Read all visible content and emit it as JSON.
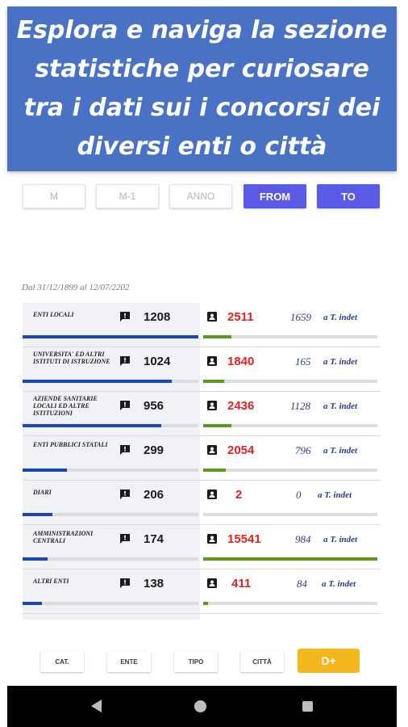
{
  "banner": {
    "text": "Esplora e naviga la sezione statistiche per curiosare tra i dati sui i concorsi dei diversi enti o città"
  },
  "filters": {
    "m": "M",
    "m1": "M-1",
    "anno": "ANNO",
    "from": "FROM",
    "to": "TO"
  },
  "date_range": "Dal 31/12/1899 al 12/07/2202",
  "indet_suffix": "a T. indet",
  "colors": {
    "banner": "#4a72c4",
    "active_filter": "#5a5ae6",
    "left_bar": "#1e45b8",
    "right_bar": "#5a9a1e",
    "red_count": "#e52222",
    "dplus": "#f5b81c"
  },
  "rows": [
    {
      "category": "ENTI LOCALI",
      "concorsi": "1208",
      "bandi": "2511",
      "indet": "1659",
      "left_level": 1.0,
      "right_level": 0.16
    },
    {
      "category": "UNIVERSITA' ED ALTRI ISTITUTI DI ISTRUZIONE",
      "concorsi": "1024",
      "bandi": "1840",
      "indet": "165",
      "left_level": 0.85,
      "right_level": 0.12
    },
    {
      "category": "AZIENDE SANITARIE LOCALI ED ALTRE ISTITUZIONI",
      "concorsi": "956",
      "bandi": "2436",
      "indet": "1128",
      "left_level": 0.79,
      "right_level": 0.16
    },
    {
      "category": "ENTI PUBBLICI STATALI",
      "concorsi": "299",
      "bandi": "2054",
      "indet": "796",
      "left_level": 0.25,
      "right_level": 0.13
    },
    {
      "category": "DIARI",
      "concorsi": "206",
      "bandi": "2",
      "indet": "0",
      "left_level": 0.17,
      "right_level": 0.0
    },
    {
      "category": "AMMINISTRAZIONI CENTRALI",
      "concorsi": "174",
      "bandi": "15541",
      "indet": "984",
      "left_level": 0.14,
      "right_level": 1.0
    },
    {
      "category": "ALTRI ENTI",
      "concorsi": "138",
      "bandi": "411",
      "indet": "84",
      "left_level": 0.11,
      "right_level": 0.03
    }
  ],
  "bottom_buttons": {
    "cat": "CAT.",
    "ente": "ENTE",
    "tipo": "TIPO",
    "citta": "CITTÀ",
    "dplus": "D+"
  },
  "nav": {
    "back_icon": "back-triangle",
    "home_icon": "home-circle",
    "recents_icon": "recents-square"
  }
}
